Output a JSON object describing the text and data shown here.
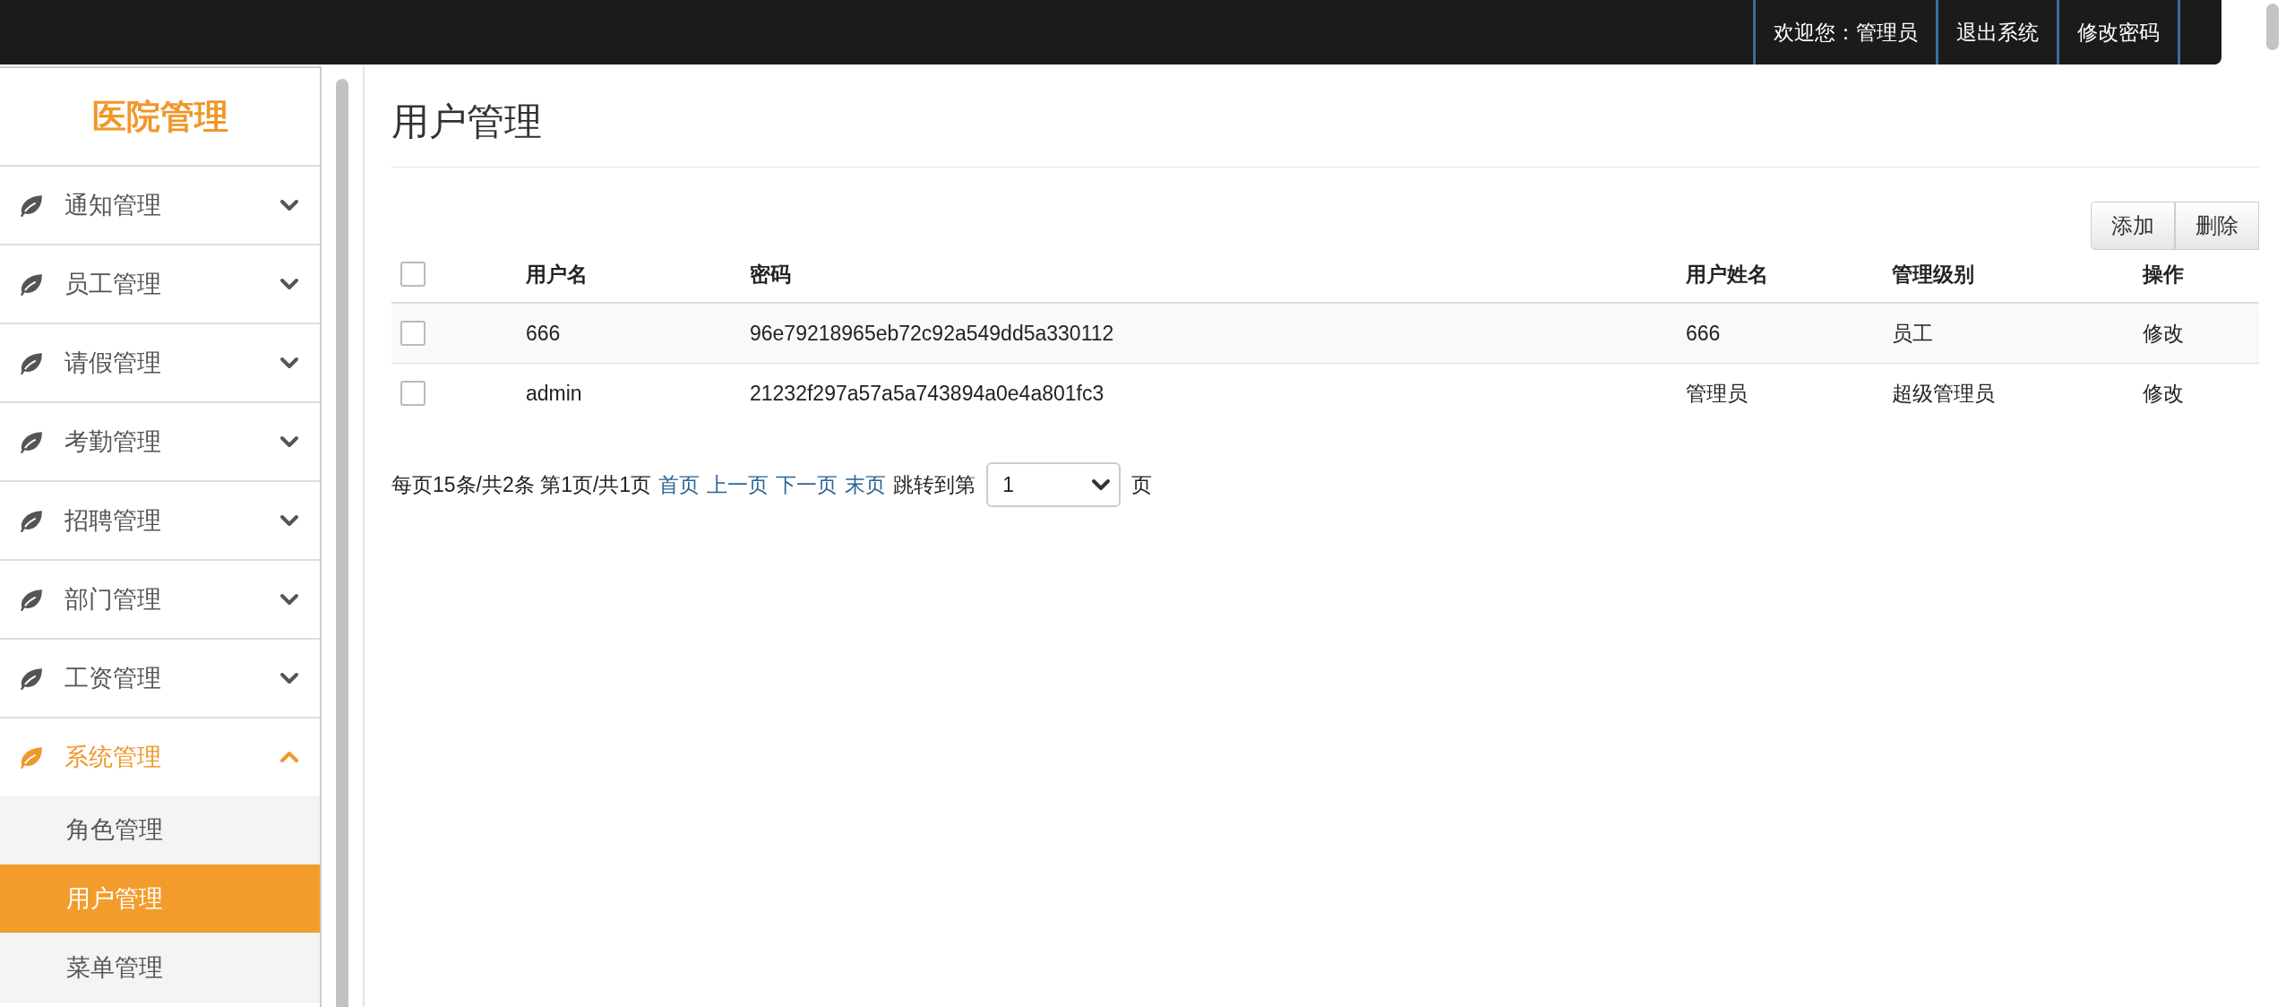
{
  "topbar": {
    "items": [
      {
        "label": "欢迎您：管理员"
      },
      {
        "label": "退出系统"
      },
      {
        "label": "修改密码"
      }
    ]
  },
  "sidebar": {
    "title": "医院管理",
    "items": [
      {
        "label": "通知管理",
        "expanded": false
      },
      {
        "label": "员工管理",
        "expanded": false
      },
      {
        "label": "请假管理",
        "expanded": false
      },
      {
        "label": "考勤管理",
        "expanded": false
      },
      {
        "label": "招聘管理",
        "expanded": false
      },
      {
        "label": "部门管理",
        "expanded": false
      },
      {
        "label": "工资管理",
        "expanded": false
      },
      {
        "label": "系统管理",
        "expanded": true,
        "children": [
          {
            "label": "角色管理",
            "selected": false
          },
          {
            "label": "用户管理",
            "selected": true
          },
          {
            "label": "菜单管理",
            "selected": false
          }
        ]
      }
    ]
  },
  "page": {
    "title": "用户管理",
    "actions": [
      "添加",
      "删除"
    ],
    "table": {
      "header_checked": false,
      "columns": [
        "用户名",
        "密码",
        "用户姓名",
        "管理级别",
        "操作"
      ],
      "rows": [
        {
          "checked": false,
          "cells": [
            "666",
            "96e79218965eb72c92a549dd5a330112",
            "666",
            "员工"
          ],
          "action": "修改"
        },
        {
          "checked": false,
          "cells": [
            "admin",
            "21232f297a57a5a743894a0e4a801fc3",
            "管理员",
            "超级管理员"
          ],
          "action": "修改"
        }
      ]
    },
    "pagination": {
      "summary": "每页15条/共2条 第1页/共1页",
      "links": [
        "首页",
        "上一页",
        "下一页",
        "末页"
      ],
      "jump_label": "跳转到第",
      "page_value": "1",
      "page_suffix": "页"
    }
  }
}
